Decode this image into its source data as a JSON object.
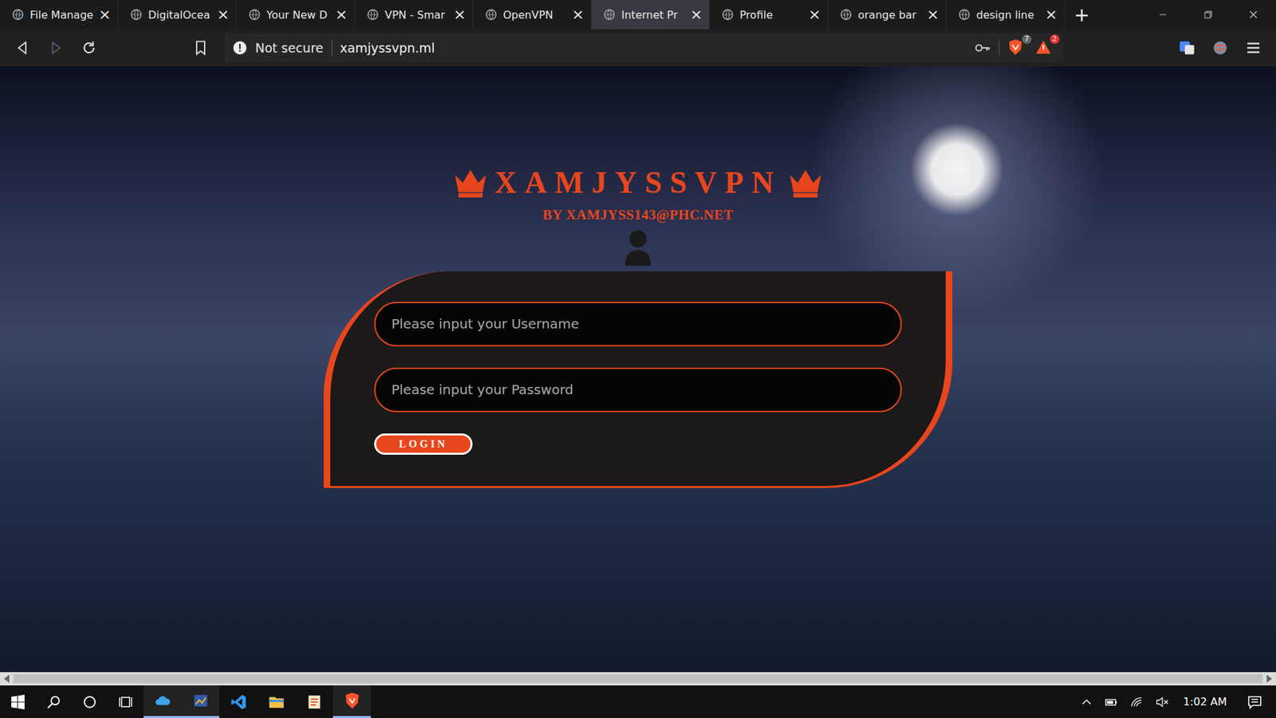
{
  "browser": {
    "tabs": [
      {
        "label": "File Manage",
        "selected": false
      },
      {
        "label": "DigitalOcea",
        "selected": false
      },
      {
        "label": "Your New D",
        "selected": false
      },
      {
        "label": "VPN - Smar",
        "selected": false
      },
      {
        "label": "OpenVPN",
        "selected": false
      },
      {
        "label": "Internet Pr",
        "selected": true
      },
      {
        "label": "Profile",
        "selected": false
      },
      {
        "label": "orange bar",
        "selected": false
      },
      {
        "label": "design line",
        "selected": false
      }
    ],
    "close": "×",
    "new_tab": "+",
    "address": {
      "security": "Not secure",
      "url": "xamjyssvpn.ml"
    },
    "shields_badge": "7",
    "alerts_badge": "2"
  },
  "page": {
    "title": "XAMJYSSVPN",
    "subtitle": "BY XAMJYSS143@PHC.NET",
    "username": {
      "placeholder": "Please input your Username"
    },
    "password": {
      "placeholder": "Please input your Password"
    },
    "login_button": "LOGIN"
  },
  "taskbar": {
    "clock": "1:02 AM"
  }
}
